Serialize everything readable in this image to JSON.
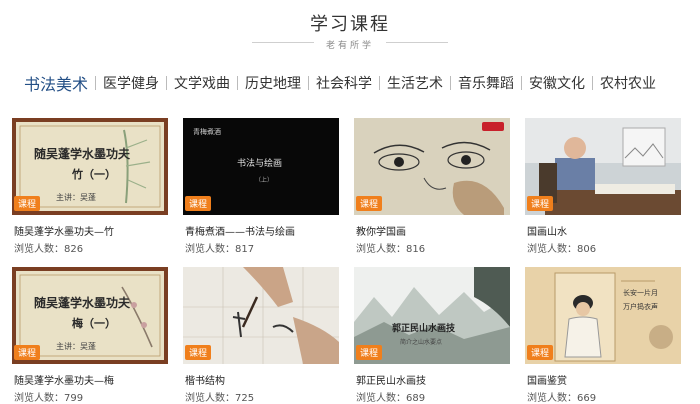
{
  "header": {
    "title": "学习课程",
    "subtitle": "老有所学"
  },
  "tabs": [
    "书法美术",
    "医学健身",
    "文学戏曲",
    "历史地理",
    "社会科学",
    "生活艺术",
    "音乐舞蹈",
    "安徽文化",
    "农村农业"
  ],
  "active_tab": 0,
  "views_label": "浏览人数：",
  "badge_text": "课程",
  "courses": [
    {
      "title": "随吴蓬学水墨功夫—竹",
      "views": "826",
      "thumb_text": [
        "随吴蓬学水墨功夫",
        "竹（一）",
        "主讲：吴蓬"
      ]
    },
    {
      "title": "青梅煮酒——书法与绘画",
      "views": "817",
      "thumb_text": [
        "青梅煮酒",
        "书法与绘画",
        "（上）"
      ]
    },
    {
      "title": "教你学国画",
      "views": "816",
      "thumb_text": []
    },
    {
      "title": "国画山水",
      "views": "806",
      "thumb_text": []
    },
    {
      "title": "随吴蓬学水墨功夫—梅",
      "views": "799",
      "thumb_text": [
        "随吴蓬学水墨功夫",
        "梅（一）",
        "主讲：吴蓬"
      ]
    },
    {
      "title": "楷书结构",
      "views": "725",
      "thumb_text": []
    },
    {
      "title": "郭正民山水画技",
      "views": "689",
      "thumb_text": [
        "郭正民山水画技",
        "简介之山水要点"
      ]
    },
    {
      "title": "国画鉴赏",
      "views": "669",
      "thumb_text": [
        "长安一片月",
        "万户捣衣声"
      ]
    }
  ],
  "colors": {
    "accent": "#234f86",
    "badge": "#f07f1c"
  }
}
